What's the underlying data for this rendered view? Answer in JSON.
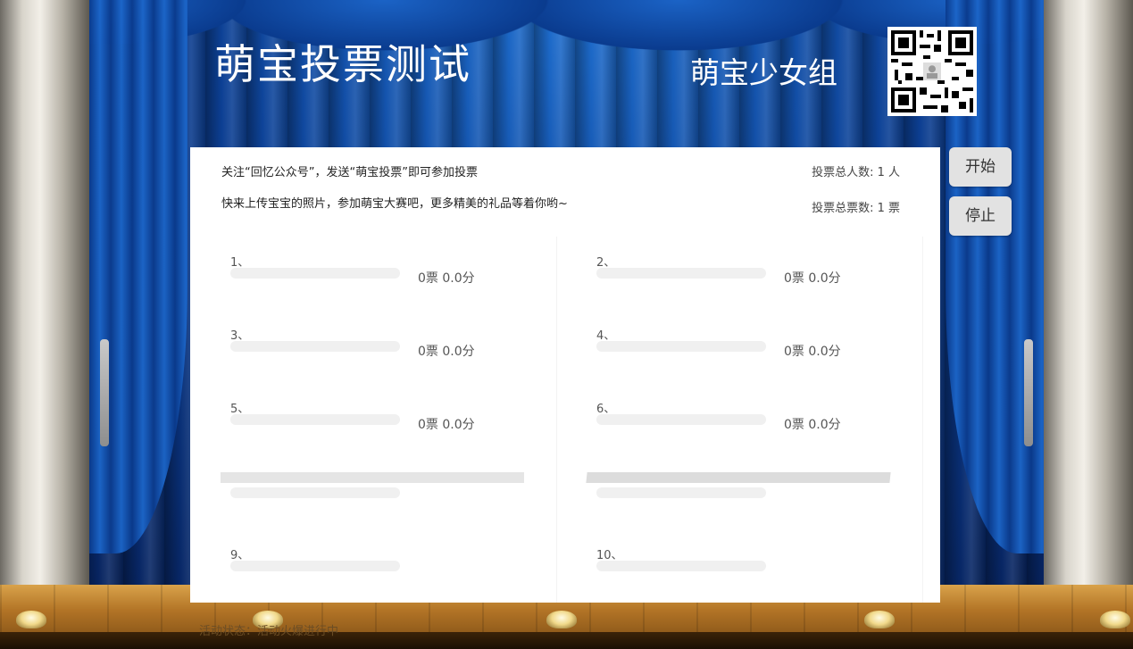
{
  "header": {
    "title": "萌宝投票测试",
    "group": "萌宝少女组",
    "qr_icon": "qr-code"
  },
  "panel": {
    "notice_line1": "关注“回忆公众号”，发送“萌宝投票”即可参加投票",
    "notice_line2": "快来上传宝宝的照片，参加萌宝大赛吧，更多精美的礼品等着你哟~",
    "total_people": "投票总人数: 1 人",
    "total_votes": "投票总票数: 1 票"
  },
  "entries": [
    {
      "rank": "1、",
      "score": "0票   0.0分"
    },
    {
      "rank": "2、",
      "score": "0票   0.0分"
    },
    {
      "rank": "3、",
      "score": "0票   0.0分"
    },
    {
      "rank": "4、",
      "score": "0票   0.0分"
    },
    {
      "rank": "5、",
      "score": "0票   0.0分"
    },
    {
      "rank": "6、",
      "score": "0票   0.0分"
    },
    {
      "rank": "",
      "score": ""
    },
    {
      "rank": "",
      "score": ""
    },
    {
      "rank": "9、",
      "score": ""
    },
    {
      "rank": "10、",
      "score": ""
    }
  ],
  "controls": {
    "start_label": "开始",
    "stop_label": "停止"
  },
  "footer": {
    "status": "活动状态：活动火爆进行中"
  },
  "colors": {
    "curtain": "#0c3f93",
    "panel_bg": "#ffffff",
    "button_bg": "#e2e2e2"
  }
}
